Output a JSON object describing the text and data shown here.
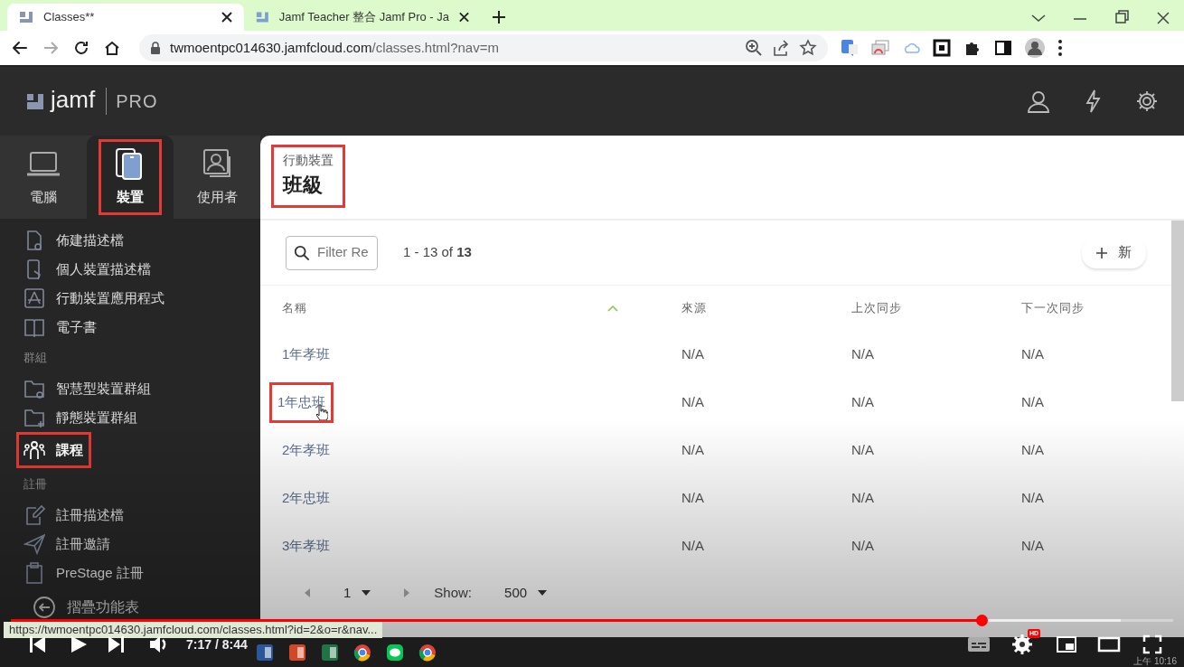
{
  "browser": {
    "tabs": [
      {
        "title": "Classes**",
        "selected": true
      },
      {
        "title": "Jamf Teacher 整合 Jamf Pro - Ja",
        "selected": false
      }
    ],
    "url": {
      "host": "twmoentpc014630.jamfcloud.com",
      "path": "/classes.html?nav=m"
    }
  },
  "app": {
    "logo": "jamf",
    "product": "PRO"
  },
  "nav_tabs": [
    {
      "label": "電腦",
      "kind": "laptop",
      "selected": false,
      "highlighted": false
    },
    {
      "label": "裝置",
      "kind": "devices",
      "selected": true,
      "highlighted": true
    },
    {
      "label": "使用者",
      "kind": "user",
      "selected": false,
      "highlighted": false
    }
  ],
  "sidebar": {
    "sections": [
      {
        "items": [
          {
            "label": "佈建描述檔",
            "kind": "doc",
            "selected": false,
            "highlighted": false
          },
          {
            "label": "個人裝置描述檔",
            "kind": "phone",
            "selected": false,
            "highlighted": false
          },
          {
            "label": "行動裝置應用程式",
            "kind": "app",
            "selected": false,
            "highlighted": false
          },
          {
            "label": "電子書",
            "kind": "book",
            "selected": false,
            "highlighted": false
          }
        ]
      },
      {
        "heading": "群組",
        "items": [
          {
            "label": "智慧型裝置群組",
            "kind": "smartfolder",
            "selected": false,
            "highlighted": false
          },
          {
            "label": "靜態裝置群組",
            "kind": "folderplus",
            "selected": false,
            "highlighted": false
          },
          {
            "label": "課程",
            "kind": "people",
            "selected": true,
            "highlighted": true
          }
        ]
      },
      {
        "heading": "註冊",
        "items": [
          {
            "label": "註冊描述檔",
            "kind": "edit",
            "selected": false,
            "highlighted": false
          },
          {
            "label": "註冊邀請",
            "kind": "send",
            "selected": false,
            "highlighted": false
          },
          {
            "label": "PreStage 註冊",
            "kind": "clipboard",
            "selected": false,
            "highlighted": false
          }
        ]
      }
    ],
    "collapse": "摺疊功能表"
  },
  "header": {
    "breadcrumb": "行動裝置",
    "title": "班級",
    "highlighted": true
  },
  "toolbar": {
    "search": {
      "placeholder": "Filter Re"
    },
    "count": "1 - 13 of **13**",
    "new_button": "新"
  },
  "table": {
    "columns": [
      {
        "label": "名稱",
        "sorted": true
      },
      {
        "label": "來源"
      },
      {
        "label": "上次同步"
      },
      {
        "label": "下一次同步"
      }
    ],
    "rows": [
      {
        "cells": [
          "1年孝班",
          "N/A",
          "N/A",
          "N/A"
        ],
        "highlighted": false,
        "hovered": false
      },
      {
        "cells": [
          "1年忠班",
          "N/A",
          "N/A",
          "N/A"
        ],
        "highlighted": true,
        "hovered": true
      },
      {
        "cells": [
          "2年孝班",
          "N/A",
          "N/A",
          "N/A"
        ],
        "highlighted": false,
        "hovered": false
      },
      {
        "cells": [
          "2年忠班",
          "N/A",
          "N/A",
          "N/A"
        ],
        "highlighted": false,
        "hovered": false
      },
      {
        "cells": [
          "3年孝班",
          "N/A",
          "N/A",
          "N/A"
        ],
        "highlighted": false,
        "hovered": false
      }
    ]
  },
  "pagination": {
    "page": "1",
    "show_label": "Show:",
    "page_size": "500"
  },
  "status_url": "https://twmoentpc014630.jamfcloud.com/classes.html?id=2&o=r&nav...",
  "player": {
    "time": "7:17 / 8:44",
    "progress": {
      "level": 0.835
    },
    "buffer": {
      "level": 0.955
    },
    "hd_badge": "HD"
  },
  "taskbar": {
    "clock": "上午 10:16"
  }
}
